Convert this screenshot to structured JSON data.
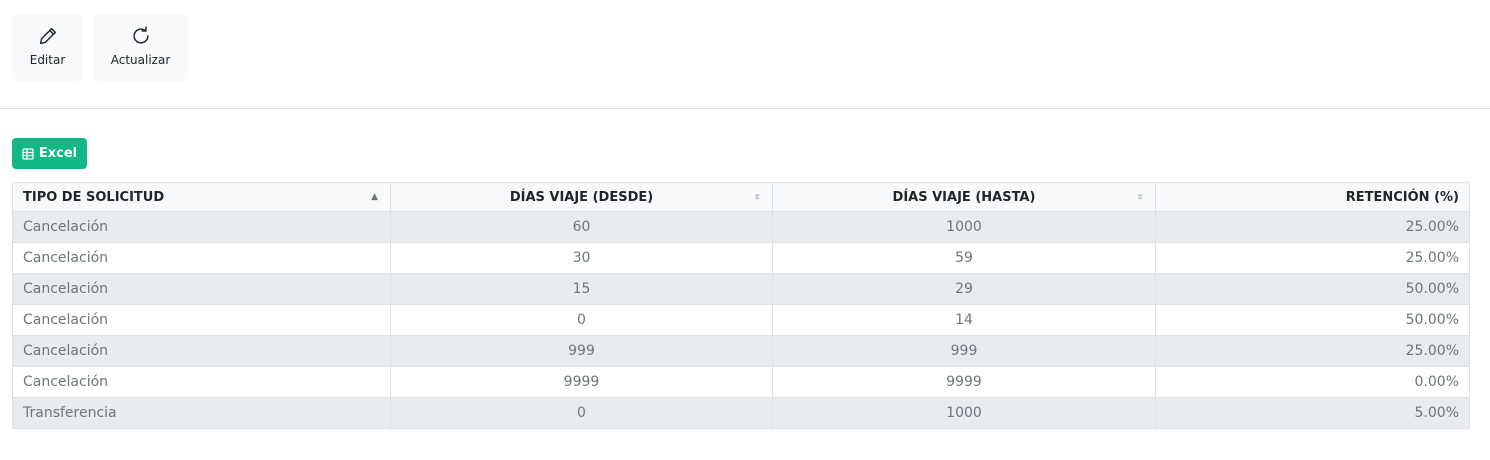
{
  "toolbar": {
    "edit_label": "Editar",
    "refresh_label": "Actualizar"
  },
  "excel_button": {
    "label": "Excel",
    "color": "#12b886"
  },
  "table": {
    "columns": [
      {
        "label": "TIPO DE SOLICITUD",
        "sort": "asc"
      },
      {
        "label": "DÍAS VIAJE (DESDE)",
        "sort": "none"
      },
      {
        "label": "DÍAS VIAJE (HASTA)",
        "sort": "none"
      },
      {
        "label": "RETENCIÓN (%)",
        "sort": "none"
      }
    ],
    "rows": [
      [
        "Cancelación",
        "60",
        "1000",
        "25.00%"
      ],
      [
        "Cancelación",
        "30",
        "59",
        "25.00%"
      ],
      [
        "Cancelación",
        "15",
        "29",
        "50.00%"
      ],
      [
        "Cancelación",
        "0",
        "14",
        "50.00%"
      ],
      [
        "Cancelación",
        "999",
        "999",
        "25.00%"
      ],
      [
        "Cancelación",
        "9999",
        "9999",
        "0.00%"
      ],
      [
        "Transferencia",
        "0",
        "1000",
        "5.00%"
      ]
    ]
  }
}
